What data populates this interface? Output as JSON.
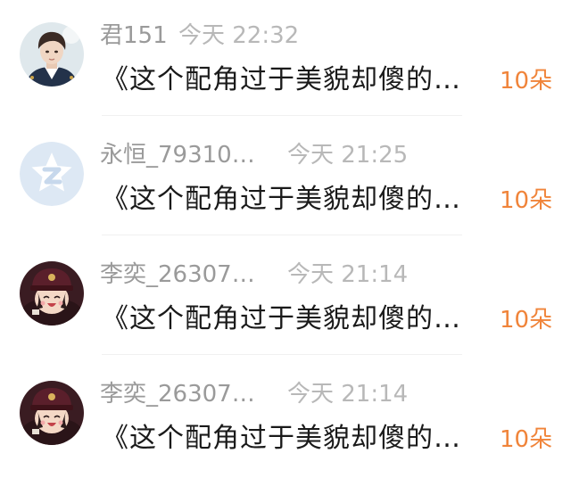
{
  "items": [
    {
      "username": "君151",
      "time": "今天 22:32",
      "message": "《这个配角过于美貌却傻的…",
      "count": "10朵",
      "avatar": "avatar-boy-portrait"
    },
    {
      "username": "永恒_79310…",
      "time": "今天 21:25",
      "message": "《这个配角过于美貌却傻的…",
      "count": "10朵",
      "avatar": "default-z-avatar"
    },
    {
      "username": "李奕_26307…",
      "time": "今天 21:14",
      "message": "《这个配角过于美貌却傻的…",
      "count": "10朵",
      "avatar": "anime-girl-hat-avatar"
    },
    {
      "username": "李奕_26307…",
      "time": "今天 21:14",
      "message": "《这个配角过于美貌却傻的…",
      "count": "10朵",
      "avatar": "anime-girl-hat-avatar"
    }
  ],
  "colors": {
    "username": "#9a9a9a",
    "time": "#b8b8b8",
    "message": "#1a1a1a",
    "count": "#f0843a",
    "divider": "#f0f0f0"
  }
}
